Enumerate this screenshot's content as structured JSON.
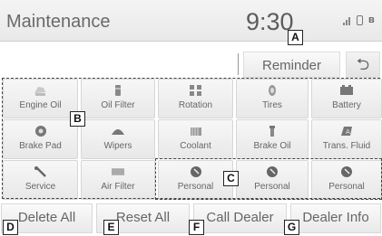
{
  "header": {
    "title": "Maintenance",
    "clock": "9:30",
    "icons": [
      "signal-icon",
      "phone-icon",
      "bluetooth-icon"
    ]
  },
  "subbar": {
    "reminder_label": "Reminder",
    "back_icon": "back-arrow-icon"
  },
  "tiles": [
    {
      "label": "Engine Oil",
      "icon": "oil-can-icon"
    },
    {
      "label": "Oil Filter",
      "icon": "oil-filter-icon"
    },
    {
      "label": "Rotation",
      "icon": "tire-rotation-icon"
    },
    {
      "label": "Tires",
      "icon": "tire-icon"
    },
    {
      "label": "Battery",
      "icon": "battery-icon"
    },
    {
      "label": "Brake Pad",
      "icon": "brake-pad-icon"
    },
    {
      "label": "Wipers",
      "icon": "wiper-icon"
    },
    {
      "label": "Coolant",
      "icon": "coolant-icon"
    },
    {
      "label": "Brake Oil",
      "icon": "brake-oil-icon"
    },
    {
      "label": "Trans. Fluid",
      "icon": "transmission-fluid-icon"
    },
    {
      "label": "Service",
      "icon": "wrench-icon"
    },
    {
      "label": "Air Filter",
      "icon": "air-filter-icon"
    },
    {
      "label": "Personal",
      "icon": "personal-icon"
    },
    {
      "label": "Personal",
      "icon": "personal-icon"
    },
    {
      "label": "Personal",
      "icon": "personal-icon"
    }
  ],
  "bottom": {
    "delete_all": "Delete All",
    "reset_all": "Reset All",
    "call_dealer": "Call Dealer",
    "dealer_info": "Dealer Info"
  },
  "callouts": {
    "a": "A",
    "b": "B",
    "c": "C",
    "d": "D",
    "e": "E",
    "f": "F",
    "g": "G"
  }
}
